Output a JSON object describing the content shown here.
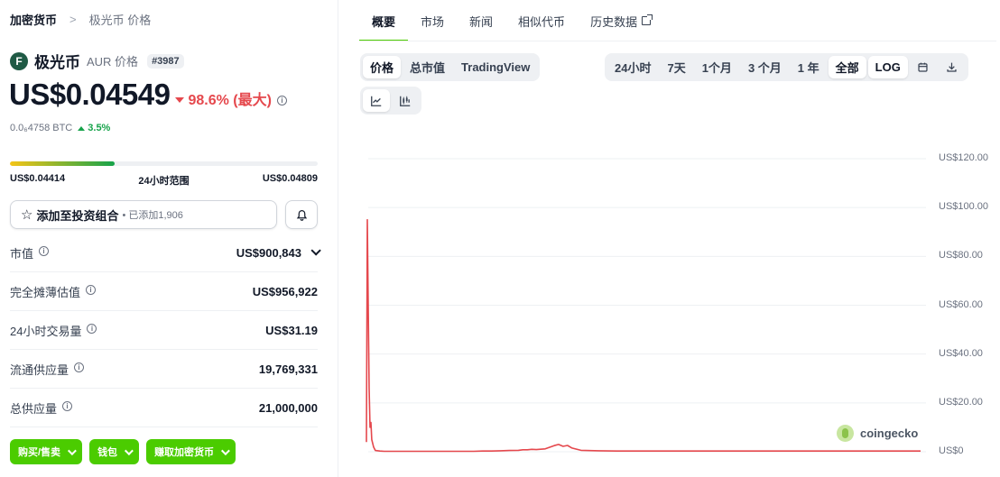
{
  "breadcrumb": {
    "root": "加密货币",
    "separator": ">",
    "current": "极光币 价格"
  },
  "coin": {
    "logo_letter": "F",
    "name": "极光币",
    "symbol_label": "AUR 价格",
    "rank": "#3987",
    "price": "US$0.04549",
    "change": "98.6% (最大)",
    "btc_price": "0.0₆4758 BTC",
    "btc_change": "3.5%",
    "logo_color": "#1f5a45"
  },
  "range": {
    "low": "US$0.04414",
    "label": "24小时范围",
    "high": "US$0.04809",
    "fill_fraction": 0.34
  },
  "portfolio": {
    "label": "添加至投资组合",
    "added": "• 已添加1,906"
  },
  "stats": [
    {
      "label": "市值",
      "value": "US$900,843"
    },
    {
      "label": "完全摊薄估值",
      "value": "US$956,922"
    },
    {
      "label": "24小时交易量",
      "value": "US$31.19"
    },
    {
      "label": "流通供应量",
      "value": "19,769,331"
    },
    {
      "label": "总供应量",
      "value": "21,000,000"
    }
  ],
  "actions": {
    "buy_sell": "购买/售卖",
    "wallet": "钱包",
    "earn": "赚取加密货币"
  },
  "tabs": {
    "overview": "概要",
    "markets": "市场",
    "news": "新闻",
    "similar": "相似代币",
    "history": "历史数据"
  },
  "chart_type_toggle": {
    "price": "价格",
    "market_cap": "总市值",
    "tradingview": "TradingView"
  },
  "time_range": {
    "d1": "24小时",
    "d7": "7天",
    "m1": "1个月",
    "m3": "3 个月",
    "y1": "1 年",
    "all": "全部",
    "log": "LOG"
  },
  "watermark": "coingecko",
  "colors": {
    "accent_green": "#4bcc00",
    "negative_red": "#e5484d",
    "positive_green": "#16a34a",
    "line_red": "#e5484d"
  },
  "chart_data": {
    "type": "line",
    "title": "",
    "xlabel": "",
    "ylabel": "",
    "y_tick_labels": [
      "US$120.00",
      "US$100.00",
      "US$80.00",
      "US$60.00",
      "US$40.00",
      "US$20.00",
      "US$0"
    ],
    "ylim": [
      0,
      120
    ],
    "grid": true,
    "series": [
      {
        "x": [
          0,
          1,
          2,
          3,
          4,
          5,
          6,
          8,
          10,
          15,
          20,
          30,
          40,
          50,
          60,
          70,
          80,
          90,
          100,
          110,
          120,
          130,
          140,
          150,
          160,
          170,
          175,
          180,
          185,
          190,
          200,
          210,
          215,
          220,
          225,
          230,
          240,
          260,
          280,
          300,
          320,
          340,
          360,
          380,
          400,
          420,
          440,
          460,
          480,
          500,
          520,
          540,
          560,
          580,
          600,
          620
        ],
        "y": [
          4,
          95,
          60,
          26,
          10,
          12,
          5,
          2,
          0.5,
          0.3,
          0.2,
          0.2,
          0.2,
          0.2,
          0.2,
          0.2,
          0.2,
          0.2,
          0.2,
          0.2,
          0.2,
          0.3,
          0.3,
          0.4,
          0.5,
          0.6,
          0.8,
          0.8,
          1.0,
          0.9,
          1.2,
          2.5,
          3.0,
          2.2,
          2.6,
          1.5,
          0.6,
          0.4,
          0.3,
          0.3,
          0.3,
          0.3,
          0.3,
          0.3,
          0.3,
          0.3,
          0.3,
          0.3,
          0.3,
          0.3,
          0.3,
          0.3,
          0.3,
          0.3,
          0.3,
          0.3
        ]
      }
    ]
  }
}
